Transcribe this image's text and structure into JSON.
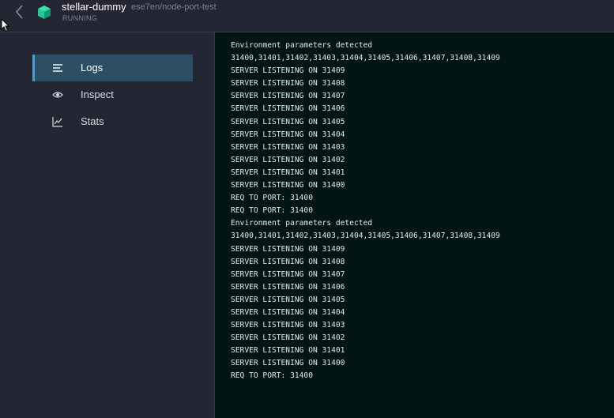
{
  "header": {
    "back_icon": "chevron-left-icon",
    "container_icon": "cube-icon",
    "title": "stellar-dummy",
    "subtitle": "ese7en/node-port-test",
    "status": "RUNNING",
    "accent_color": "#20c997"
  },
  "sidebar": {
    "items": [
      {
        "label": "Logs",
        "icon": "lines-icon",
        "active": true
      },
      {
        "label": "Inspect",
        "icon": "eye-icon",
        "active": false
      },
      {
        "label": "Stats",
        "icon": "chart-icon",
        "active": false
      }
    ],
    "active_color": "#2d4f66"
  },
  "logs": {
    "lines": [
      "Environment parameters detected",
      "31400,31401,31402,31403,31404,31405,31406,31407,31408,31409",
      "SERVER LISTENING ON 31409",
      "SERVER LISTENING ON 31408",
      "SERVER LISTENING ON 31407",
      "SERVER LISTENING ON 31406",
      "SERVER LISTENING ON 31405",
      "SERVER LISTENING ON 31404",
      "SERVER LISTENING ON 31403",
      "SERVER LISTENING ON 31402",
      "SERVER LISTENING ON 31401",
      "SERVER LISTENING ON 31400",
      "REQ TO PORT: 31400",
      "REQ TO PORT: 31400",
      "Environment parameters detected",
      "31400,31401,31402,31403,31404,31405,31406,31407,31408,31409",
      "SERVER LISTENING ON 31409",
      "SERVER LISTENING ON 31408",
      "SERVER LISTENING ON 31407",
      "SERVER LISTENING ON 31406",
      "SERVER LISTENING ON 31405",
      "SERVER LISTENING ON 31404",
      "SERVER LISTENING ON 31403",
      "SERVER LISTENING ON 31402",
      "SERVER LISTENING ON 31401",
      "SERVER LISTENING ON 31400",
      "REQ TO PORT: 31400"
    ],
    "background": "#011612"
  }
}
